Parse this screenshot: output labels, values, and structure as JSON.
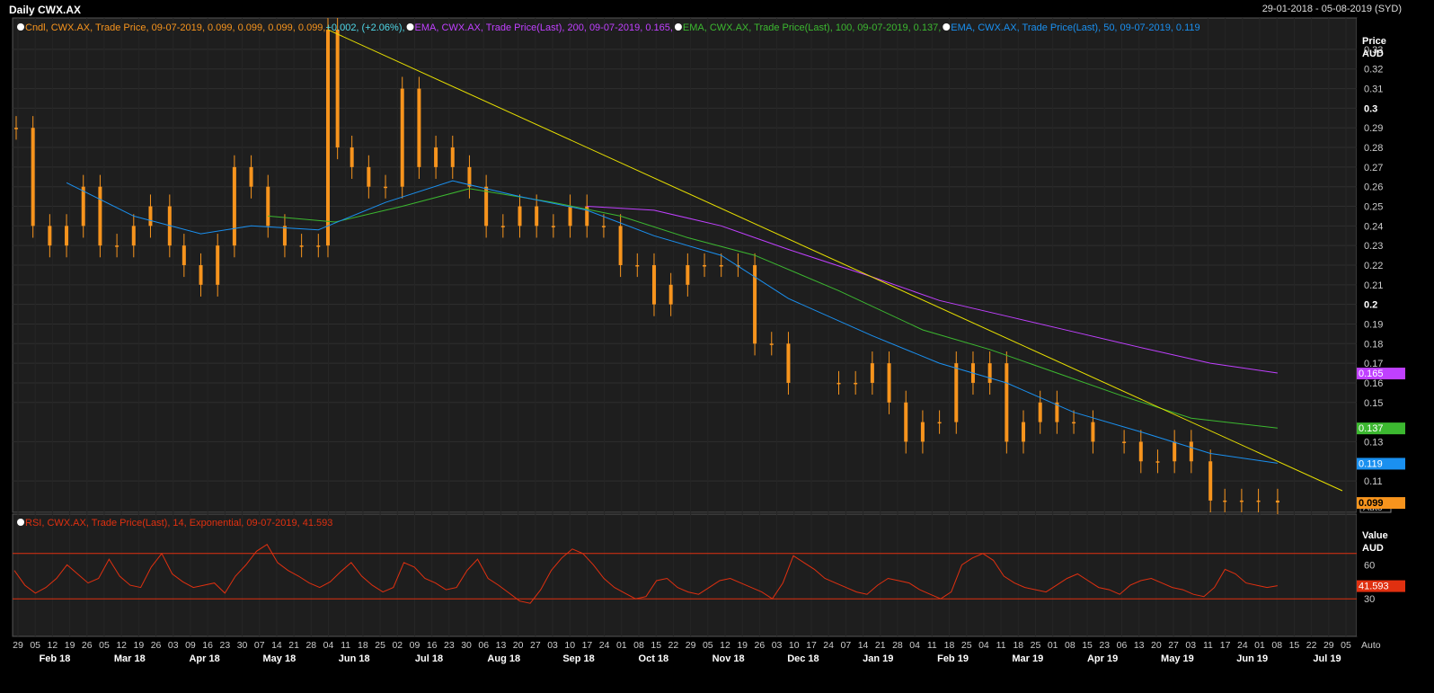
{
  "header": {
    "title": "Daily CWX.AX",
    "range": "29-01-2018 - 05-08-2019 (SYD)"
  },
  "colors": {
    "candle": "#f7941d",
    "ema200": "#c040ff",
    "ema100": "#3cb830",
    "ema50": "#1a90f0",
    "trend": "#e8e000",
    "rsi": "#e03010",
    "rsi_band": "#e03010",
    "grid": "#2e2e2e",
    "panel_bg": "#1e1e1e",
    "axis_bg": "#000000"
  },
  "legend_top": [
    {
      "icon": "info-circle-icon",
      "text": "Cndl, CWX.AX, Trade Price, 09-07-2019, 0.099, 0.099, 0.099, 0.099,",
      "extra": " +0.002, (+2.06%),",
      "color": "#f7941d",
      "extra_color": "#4fd8e8"
    },
    {
      "icon": "info-circle-icon",
      "text": "EMA, CWX.AX, Trade Price(Last),  200, 09-07-2019, 0.165,",
      "color": "#c040ff"
    },
    {
      "icon": "info-circle-icon",
      "text": "EMA, CWX.AX, Trade Price(Last),  100, 09-07-2019, 0.137,",
      "color": "#3cb830"
    },
    {
      "icon": "info-circle-icon",
      "text": "EMA, CWX.AX, Trade Price(Last),  50, 09-07-2019, 0.119",
      "color": "#1a90f0"
    }
  ],
  "legend_rsi": {
    "icon": "info-circle-icon",
    "text": "RSI, CWX.AX, Trade Price(Last), 14, Exponential, 09-07-2019, 41.593",
    "color": "#e03010"
  },
  "price_axis": {
    "title": "Price",
    "unit": "AUD",
    "auto_label": "Auto",
    "ticks": [
      "0.33",
      "0.32",
      "0.31",
      "0.3",
      "0.29",
      "0.28",
      "0.27",
      "0.26",
      "0.25",
      "0.24",
      "0.23",
      "0.22",
      "0.21",
      "0.2",
      "0.19",
      "0.18",
      "0.17",
      "0.16",
      "0.15",
      "0.13",
      "0.11"
    ],
    "bold_ticks": [
      "0.3",
      "0.2"
    ],
    "badges": [
      {
        "label": "0.165",
        "value": 0.165,
        "color": "#c040ff"
      },
      {
        "label": "0.137",
        "value": 0.137,
        "color": "#3cb830"
      },
      {
        "label": "0.119",
        "value": 0.119,
        "color": "#1a90f0"
      },
      {
        "label": "0.099",
        "value": 0.099,
        "color": "#f7941d"
      }
    ]
  },
  "rsi_axis": {
    "title": "Value",
    "unit": "AUD",
    "ticks": [
      "60",
      "30"
    ],
    "badge": {
      "label": "41.593",
      "value": 41.593,
      "color": "#e03010"
    }
  },
  "x_axis": {
    "auto_label": "Auto",
    "day_ticks": [
      "29",
      "05",
      "12",
      "19",
      "26",
      "05",
      "12",
      "19",
      "26",
      "03",
      "09",
      "16",
      "23",
      "30",
      "07",
      "14",
      "21",
      "28",
      "04",
      "11",
      "18",
      "25",
      "02",
      "09",
      "16",
      "23",
      "30",
      "06",
      "13",
      "20",
      "27",
      "03",
      "10",
      "17",
      "24",
      "01",
      "08",
      "15",
      "22",
      "29",
      "05",
      "12",
      "19",
      "26",
      "03",
      "10",
      "17",
      "24",
      "07",
      "14",
      "21",
      "28",
      "04",
      "11",
      "18",
      "25",
      "04",
      "11",
      "18",
      "25",
      "01",
      "08",
      "15",
      "23",
      "06",
      "13",
      "20",
      "27",
      "03",
      "11",
      "17",
      "24",
      "01",
      "08",
      "15",
      "22",
      "29",
      "05"
    ],
    "months": [
      "Feb 18",
      "Mar 18",
      "Apr 18",
      "May 18",
      "Jun 18",
      "Jul 18",
      "Aug 18",
      "Sep 18",
      "Oct 18",
      "Nov 18",
      "Dec 18",
      "Jan 19",
      "Feb 19",
      "Mar 19",
      "Apr 19",
      "May 19",
      "Jun 19",
      "Jul 19"
    ]
  },
  "chart_data": {
    "type": "line",
    "title": "Daily CWX.AX",
    "ylabel": "Price AUD",
    "ylim": [
      0.094,
      0.346
    ],
    "date_range": [
      "2018-01-29",
      "2019-08-05"
    ],
    "grid": true,
    "candles_weekly_close": [
      [
        "2018-01-29",
        0.29
      ],
      [
        "2018-02-05",
        0.24
      ],
      [
        "2018-02-12",
        0.23
      ],
      [
        "2018-02-19",
        0.24
      ],
      [
        "2018-02-26",
        0.26
      ],
      [
        "2018-03-05",
        0.23
      ],
      [
        "2018-03-12",
        0.23
      ],
      [
        "2018-03-19",
        0.24
      ],
      [
        "2018-03-26",
        0.25
      ],
      [
        "2018-04-03",
        0.23
      ],
      [
        "2018-04-09",
        0.22
      ],
      [
        "2018-04-16",
        0.21
      ],
      [
        "2018-04-23",
        0.23
      ],
      [
        "2018-04-30",
        0.27
      ],
      [
        "2018-05-07",
        0.26
      ],
      [
        "2018-05-14",
        0.24
      ],
      [
        "2018-05-21",
        0.23
      ],
      [
        "2018-05-28",
        0.23
      ],
      [
        "2018-06-04",
        0.23
      ],
      [
        "2018-06-08",
        0.34
      ],
      [
        "2018-06-12",
        0.28
      ],
      [
        "2018-06-18",
        0.27
      ],
      [
        "2018-06-25",
        0.26
      ],
      [
        "2018-07-02",
        0.26
      ],
      [
        "2018-07-09",
        0.31
      ],
      [
        "2018-07-16",
        0.27
      ],
      [
        "2018-07-23",
        0.28
      ],
      [
        "2018-07-30",
        0.27
      ],
      [
        "2018-08-06",
        0.26
      ],
      [
        "2018-08-13",
        0.24
      ],
      [
        "2018-08-20",
        0.24
      ],
      [
        "2018-08-27",
        0.25
      ],
      [
        "2018-09-03",
        0.24
      ],
      [
        "2018-09-10",
        0.24
      ],
      [
        "2018-09-17",
        0.25
      ],
      [
        "2018-09-24",
        0.24
      ],
      [
        "2018-10-01",
        0.24
      ],
      [
        "2018-10-08",
        0.22
      ],
      [
        "2018-10-15",
        0.22
      ],
      [
        "2018-10-22",
        0.2
      ],
      [
        "2018-10-29",
        0.21
      ],
      [
        "2018-11-05",
        0.22
      ],
      [
        "2018-11-12",
        0.22
      ],
      [
        "2018-11-19",
        0.22
      ],
      [
        "2018-11-26",
        0.22
      ],
      [
        "2018-12-03",
        0.18
      ],
      [
        "2018-12-10",
        0.18
      ],
      [
        "2018-12-17",
        0.16
      ],
      [
        "2019-01-07",
        0.16
      ],
      [
        "2019-01-14",
        0.16
      ],
      [
        "2019-01-21",
        0.17
      ],
      [
        "2019-01-28",
        0.15
      ],
      [
        "2019-02-04",
        0.13
      ],
      [
        "2019-02-11",
        0.14
      ],
      [
        "2019-02-18",
        0.14
      ],
      [
        "2019-02-25",
        0.17
      ],
      [
        "2019-03-04",
        0.16
      ],
      [
        "2019-03-11",
        0.17
      ],
      [
        "2019-03-18",
        0.13
      ],
      [
        "2019-03-25",
        0.14
      ],
      [
        "2019-04-01",
        0.15
      ],
      [
        "2019-04-08",
        0.14
      ],
      [
        "2019-04-15",
        0.14
      ],
      [
        "2019-04-23",
        0.13
      ],
      [
        "2019-05-06",
        0.13
      ],
      [
        "2019-05-13",
        0.12
      ],
      [
        "2019-05-20",
        0.12
      ],
      [
        "2019-05-27",
        0.13
      ],
      [
        "2019-06-03",
        0.12
      ],
      [
        "2019-06-11",
        0.1
      ],
      [
        "2019-06-17",
        0.1
      ],
      [
        "2019-06-24",
        0.1
      ],
      [
        "2019-07-01",
        0.1
      ],
      [
        "2019-07-09",
        0.099
      ]
    ],
    "series": [
      {
        "name": "EMA 200",
        "points": [
          [
            "2018-09-24",
            0.25
          ],
          [
            "2018-10-22",
            0.248
          ],
          [
            "2018-11-19",
            0.24
          ],
          [
            "2018-12-17",
            0.228
          ],
          [
            "2019-01-21",
            0.214
          ],
          [
            "2019-02-18",
            0.202
          ],
          [
            "2019-03-18",
            0.194
          ],
          [
            "2019-04-15",
            0.186
          ],
          [
            "2019-05-13",
            0.178
          ],
          [
            "2019-06-11",
            0.17
          ],
          [
            "2019-07-09",
            0.165
          ]
        ]
      },
      {
        "name": "EMA 100",
        "points": [
          [
            "2018-05-14",
            0.245
          ],
          [
            "2018-06-11",
            0.242
          ],
          [
            "2018-07-09",
            0.25
          ],
          [
            "2018-08-06",
            0.259
          ],
          [
            "2018-09-10",
            0.252
          ],
          [
            "2018-10-08",
            0.245
          ],
          [
            "2018-11-05",
            0.234
          ],
          [
            "2018-12-03",
            0.225
          ],
          [
            "2019-01-07",
            0.207
          ],
          [
            "2019-02-11",
            0.187
          ],
          [
            "2019-03-11",
            0.177
          ],
          [
            "2019-04-08",
            0.165
          ],
          [
            "2019-05-06",
            0.153
          ],
          [
            "2019-06-03",
            0.142
          ],
          [
            "2019-07-09",
            0.137
          ]
        ]
      },
      {
        "name": "EMA 50",
        "points": [
          [
            "2018-02-19",
            0.262
          ],
          [
            "2018-03-19",
            0.245
          ],
          [
            "2018-04-16",
            0.236
          ],
          [
            "2018-05-07",
            0.24
          ],
          [
            "2018-06-04",
            0.238
          ],
          [
            "2018-07-02",
            0.252
          ],
          [
            "2018-07-30",
            0.263
          ],
          [
            "2018-08-27",
            0.255
          ],
          [
            "2018-09-24",
            0.248
          ],
          [
            "2018-10-22",
            0.235
          ],
          [
            "2018-11-19",
            0.225
          ],
          [
            "2018-12-17",
            0.203
          ],
          [
            "2019-01-21",
            0.184
          ],
          [
            "2019-02-18",
            0.17
          ],
          [
            "2019-03-18",
            0.16
          ],
          [
            "2019-04-15",
            0.145
          ],
          [
            "2019-05-13",
            0.135
          ],
          [
            "2019-06-11",
            0.124
          ],
          [
            "2019-07-09",
            0.119
          ]
        ]
      },
      {
        "name": "Trend line",
        "points": [
          [
            "2018-06-08",
            0.34
          ],
          [
            "2019-08-05",
            0.105
          ]
        ]
      }
    ],
    "rsi": {
      "period": 14,
      "ylim": [
        0,
        100
      ],
      "bands": [
        70,
        30
      ],
      "values": [
        55,
        42,
        35,
        40,
        48,
        60,
        52,
        44,
        48,
        65,
        50,
        42,
        40,
        58,
        70,
        52,
        45,
        40,
        42,
        44,
        35,
        50,
        60,
        72,
        78,
        62,
        55,
        50,
        44,
        40,
        45,
        54,
        62,
        50,
        42,
        36,
        40,
        62,
        58,
        48,
        44,
        38,
        40,
        55,
        65,
        48,
        42,
        35,
        28,
        26,
        38,
        55,
        66,
        74,
        70,
        60,
        48,
        40,
        35,
        30,
        32,
        46,
        48,
        40,
        36,
        34,
        40,
        46,
        48,
        44,
        40,
        36,
        30,
        44,
        68,
        62,
        56,
        48,
        44,
        40,
        36,
        34,
        42,
        48,
        46,
        44,
        38,
        34,
        30,
        36,
        60,
        66,
        70,
        64,
        50,
        44,
        40,
        38,
        36,
        42,
        48,
        52,
        46,
        40,
        38,
        34,
        42,
        46,
        48,
        44,
        40,
        38,
        34,
        32,
        40,
        56,
        52,
        44,
        42,
        40,
        41.593
      ]
    }
  }
}
